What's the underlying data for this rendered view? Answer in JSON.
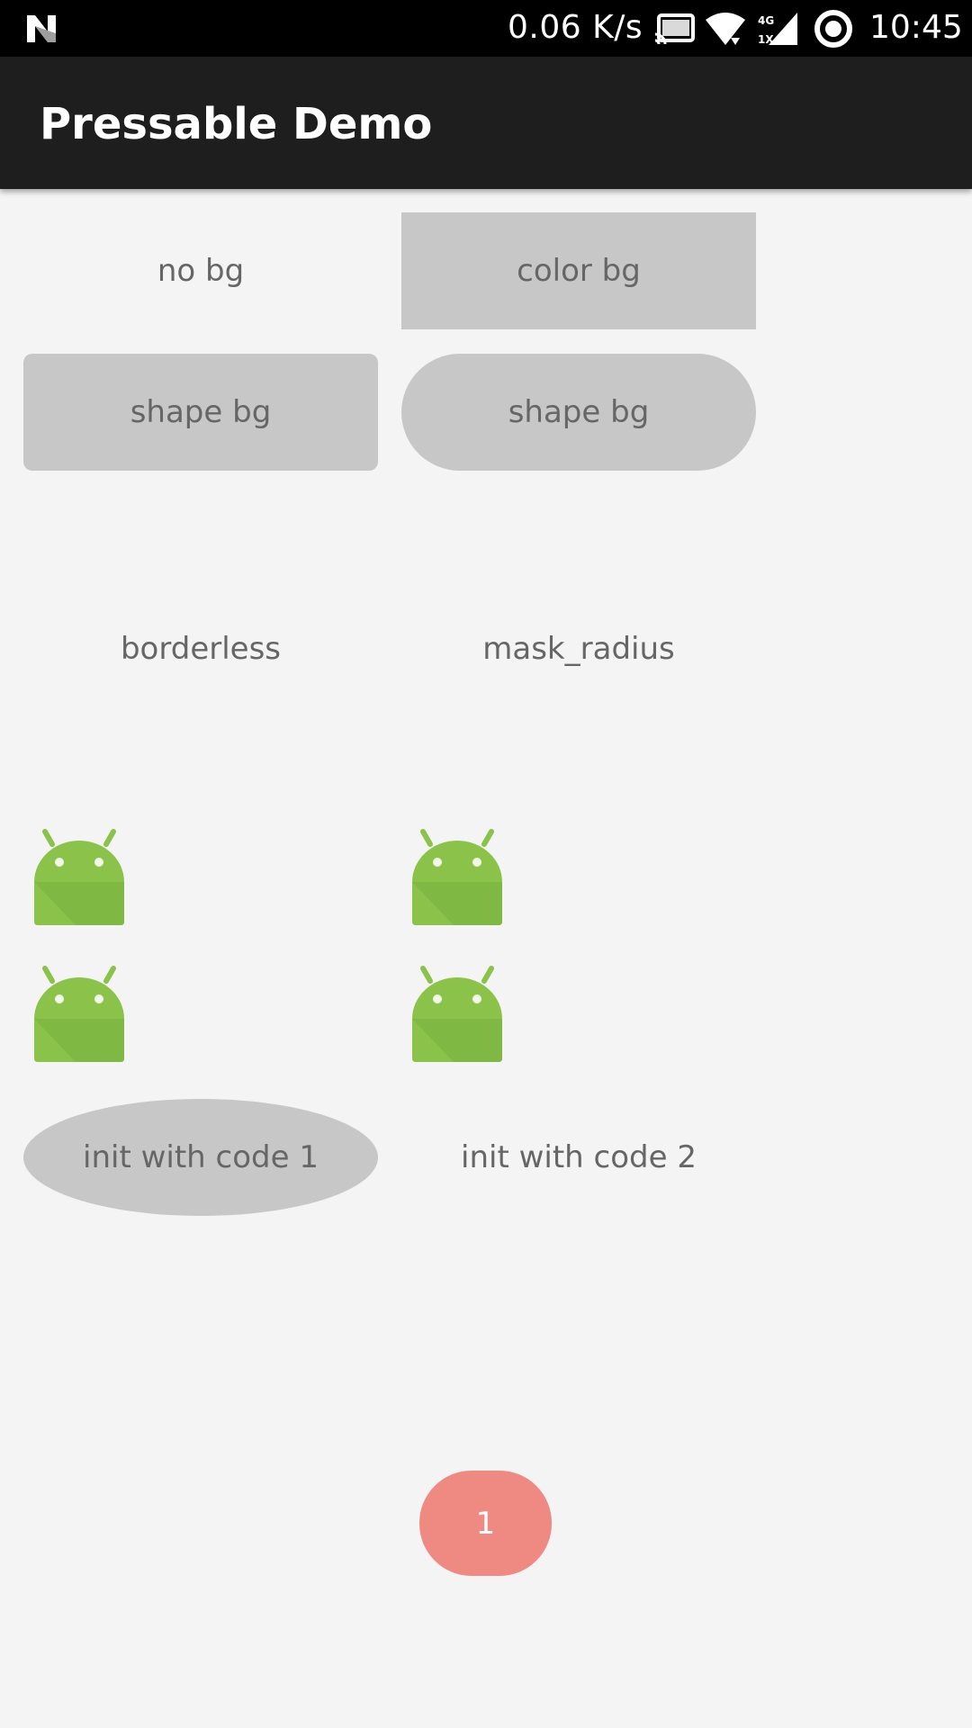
{
  "status_bar": {
    "left_icon": "n-notification-icon",
    "network_speed": "0.06 K/s",
    "icons": [
      "cast-icon",
      "wifi-icon",
      "mobile-signal-icon",
      "ring-icon"
    ],
    "net_type_top": "4G",
    "net_type_bottom": "1X",
    "time": "10:45"
  },
  "app_bar": {
    "title": "Pressable Demo"
  },
  "buttons": {
    "no_bg": "no bg",
    "color_bg": "color bg",
    "shape_bg_rect": "shape bg",
    "shape_bg_round": "shape bg",
    "borderless": "borderless",
    "mask_radius": "mask_radius",
    "init_code_1": "init with code 1",
    "init_code_2": "init with code 2"
  },
  "launcher_icons": [
    "android-icon",
    "android-icon",
    "android-icon",
    "android-icon"
  ],
  "fab": {
    "label": "1"
  },
  "colors": {
    "status_bar": "#000000",
    "app_bar": "#1e1e1e",
    "background": "#f4f4f4",
    "button_bg": "#c7c7c7",
    "button_text": "#666666",
    "android_green": "#8bc34a",
    "fab": "#ef8a83"
  }
}
